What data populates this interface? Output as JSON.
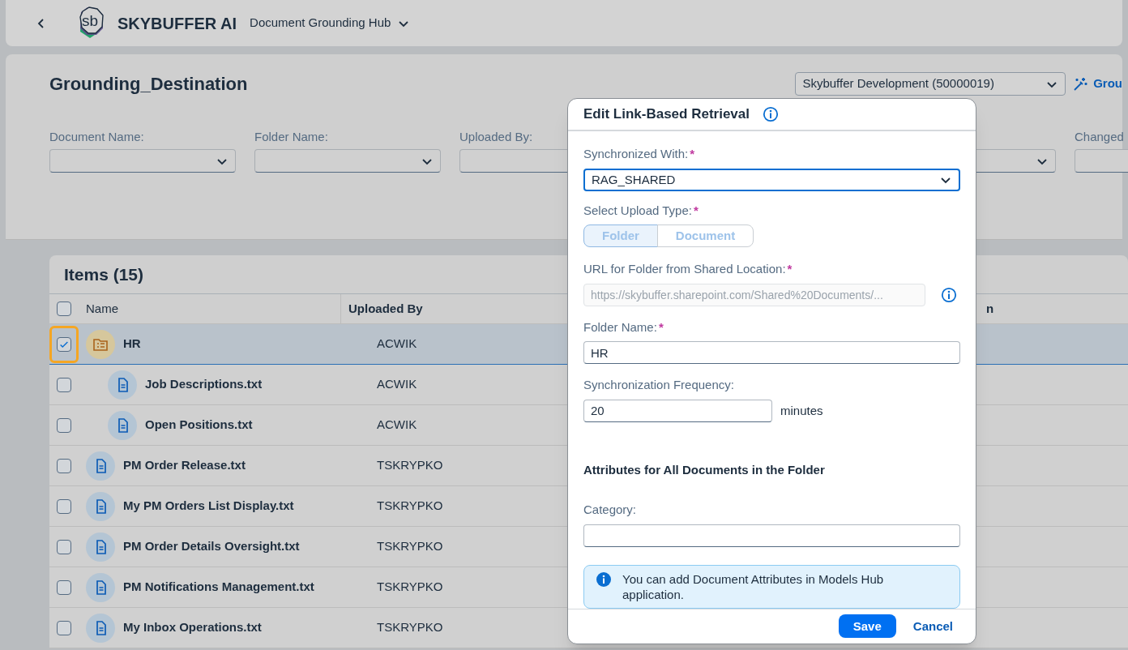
{
  "shell": {
    "logo_text": "sb",
    "brand": "SKYBUFFER AI",
    "app_title": "Document Grounding Hub"
  },
  "page": {
    "title": "Grounding_Destination",
    "system_select": "Skybuffer Development (50000019)",
    "action_link": "Grou"
  },
  "filters": [
    {
      "label": "Document Name:",
      "kind": "select"
    },
    {
      "label": "Folder Name:",
      "kind": "select"
    },
    {
      "label": "Uploaded By:",
      "kind": "box"
    },
    {
      "kind": "select"
    },
    {
      "label": "Changed",
      "kind": "box"
    }
  ],
  "table": {
    "title": "Items (15)",
    "header_checked": false,
    "columns": [
      "Name",
      "Uploaded By",
      "n"
    ],
    "rows": [
      {
        "name": "HR",
        "kind": "folder",
        "uploaded_by": "ACWIK",
        "checked": true,
        "selected": true,
        "children": [
          {
            "name": "Job Descriptions.txt",
            "kind": "document",
            "uploaded_by": "ACWIK",
            "checked": false,
            "selected": false
          },
          {
            "name": "Open Positions.txt",
            "kind": "document",
            "uploaded_by": "ACWIK",
            "checked": false,
            "selected": false
          }
        ]
      },
      {
        "name": "PM Order Release.txt",
        "kind": "document",
        "uploaded_by": "TSKRYPKO",
        "checked": false,
        "selected": false
      },
      {
        "name": "My PM Orders List Display.txt",
        "kind": "document",
        "uploaded_by": "TSKRYPKO",
        "checked": false,
        "selected": false
      },
      {
        "name": "PM Order Details Oversight.txt",
        "kind": "document",
        "uploaded_by": "TSKRYPKO",
        "checked": false,
        "selected": false
      },
      {
        "name": "PM Notifications Management.txt",
        "kind": "document",
        "uploaded_by": "TSKRYPKO",
        "checked": false,
        "selected": false
      },
      {
        "name": "My Inbox Operations.txt",
        "kind": "document",
        "uploaded_by": "TSKRYPKO",
        "checked": false,
        "selected": false
      }
    ]
  },
  "dialog": {
    "title": "Edit Link-Based Retrieval",
    "required_mark": "*",
    "synchronized_with": {
      "label": "Synchronized With:",
      "required": true,
      "value": "RAG_SHARED"
    },
    "upload_type": {
      "label": "Select Upload Type:",
      "required": true,
      "options": [
        {
          "label": "Folder",
          "selected": true
        },
        {
          "label": "Document",
          "selected": false
        }
      ]
    },
    "url": {
      "label": "URL for Folder from Shared Location:",
      "required": true,
      "placeholder": "https://skybuffer.sharepoint.com/Shared%20Documents/..."
    },
    "folder_name": {
      "label": "Folder Name:",
      "required": true,
      "value": "HR"
    },
    "frequency": {
      "label": "Synchronization Frequency:",
      "value": "20",
      "unit": "minutes"
    },
    "attributes_heading": "Attributes for All Documents in the Folder",
    "category": {
      "label": "Category:"
    },
    "info": "You can add Document Attributes in Models Hub application.",
    "buttons": {
      "save": "Save",
      "cancel": "Cancel"
    }
  }
}
